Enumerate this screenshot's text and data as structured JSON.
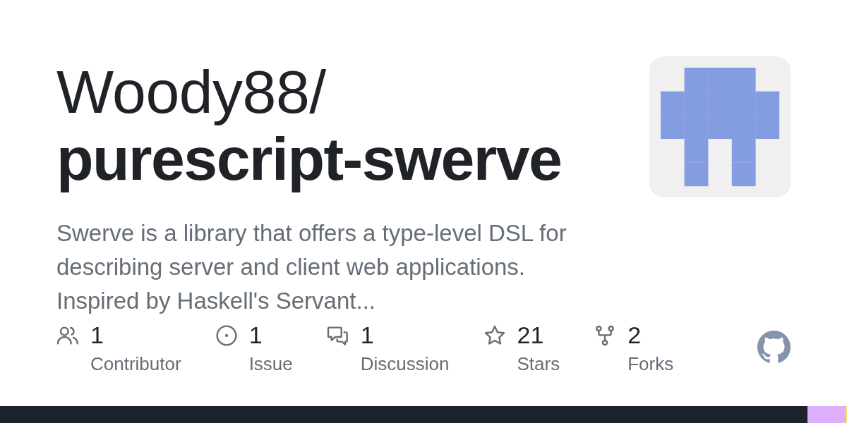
{
  "owner": "Woody88/",
  "repo": "purescript-swerve",
  "description": "Swerve is a library that offers a type-level DSL for describing server and client web applications. Inspired by Haskell's Servant...",
  "stats": [
    {
      "kind": "contributors",
      "count": "1",
      "label": "Contributor"
    },
    {
      "kind": "issues",
      "count": "1",
      "label": "Issue"
    },
    {
      "kind": "discussions",
      "count": "1",
      "label": "Discussion"
    },
    {
      "kind": "stars",
      "count": "21",
      "label": "Stars"
    },
    {
      "kind": "forks",
      "count": "2",
      "label": "Forks"
    }
  ],
  "language_bar": [
    {
      "color": "#1d222d",
      "level": 0.953
    },
    {
      "color": "#dfafff",
      "level": 0.045
    },
    {
      "color": "#f1e05a",
      "level": 0.002
    }
  ]
}
